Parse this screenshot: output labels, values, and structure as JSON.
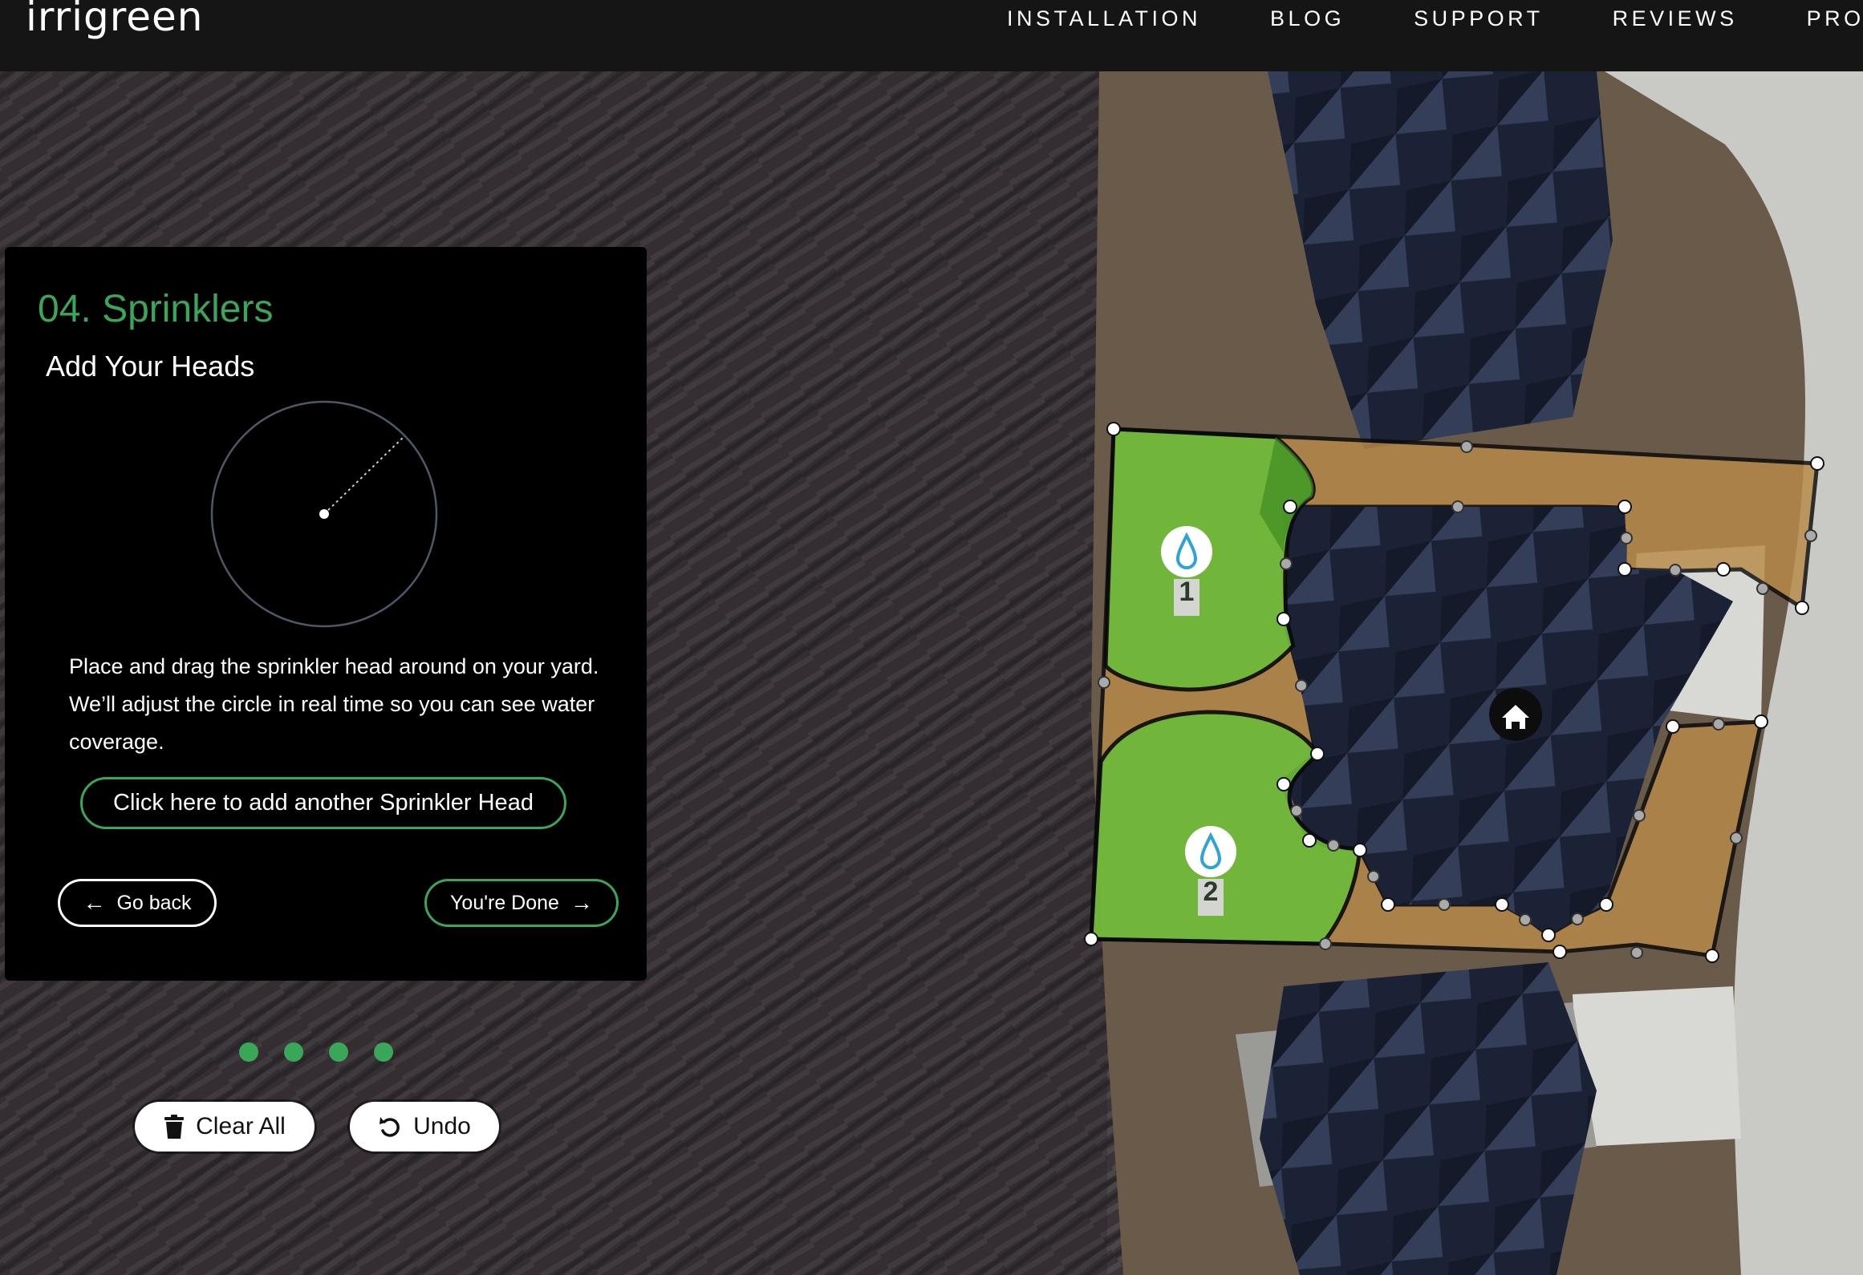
{
  "header": {
    "logo_text": "irrigreen",
    "nav": [
      "INSTALLATION",
      "BLOG",
      "SUPPORT",
      "REVIEWS",
      "PRO P"
    ]
  },
  "panel": {
    "step_title": "04. Sprinklers",
    "subtitle": "Add Your Heads",
    "description": "Place and drag the sprinkler head around on your yard. We’ll adjust the circle in real time so you can see water coverage.",
    "add_button": "Click here to add another Sprinkler Head",
    "back_button": "Go back",
    "done_button": "You're Done"
  },
  "progress": {
    "steps_total": 4,
    "steps_visible": 4
  },
  "toolbar": {
    "clear_label": "Clear All",
    "undo_label": "Undo"
  },
  "map": {
    "sprinkler_heads": [
      {
        "label": "1",
        "icon": "water-drop-icon"
      },
      {
        "label": "2",
        "icon": "water-drop-icon"
      }
    ],
    "house_icon": "home-icon",
    "colors": {
      "coverage_green": "#6dbb3a",
      "yard_brown": "#b98a48",
      "accent_green": "#3aa65a",
      "water_blue": "#2ea3d6"
    }
  }
}
